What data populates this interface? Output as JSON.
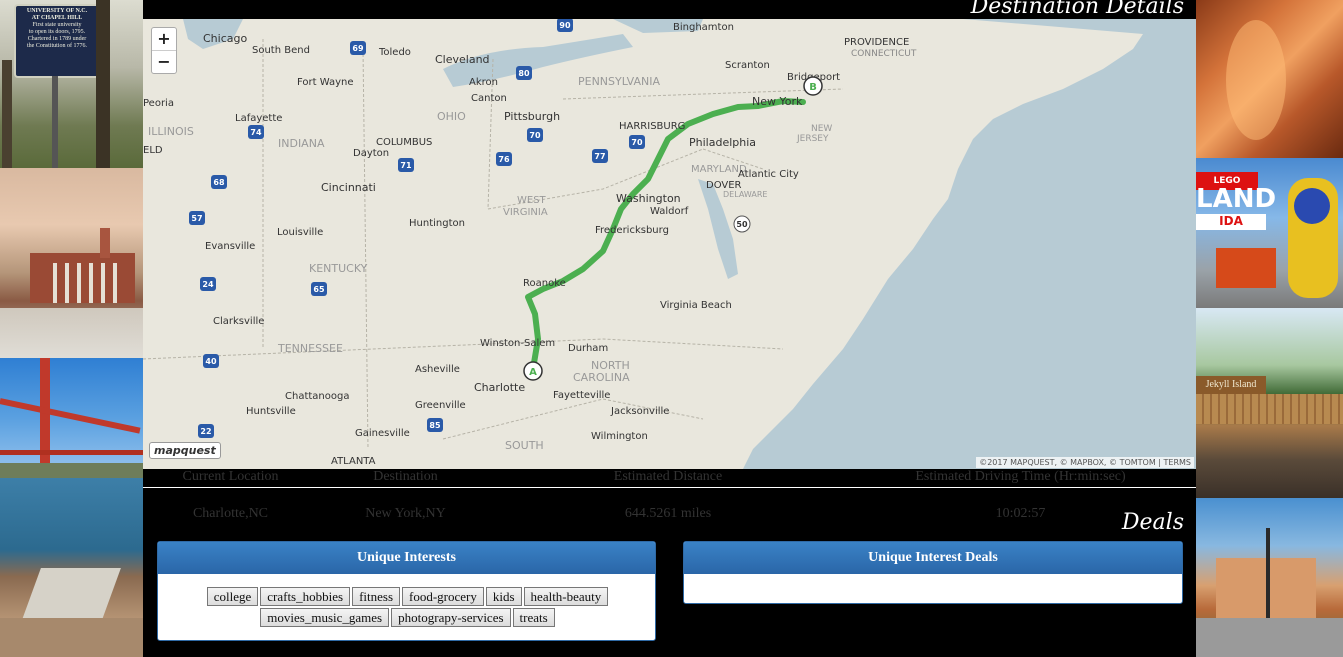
{
  "left_panel": {
    "sign_text": [
      "UNIVERSITY OF N.C.",
      "AT CHAPEL HILL",
      "First state university",
      "to open its doors, 1795.",
      "Chartered in 1789 under",
      "the Constitution of 1776."
    ]
  },
  "right_panel": {
    "legoland_text": "LAND",
    "legoland_sub": "IDA",
    "legoland_logo": "LEGO",
    "jekyll_sign": "Jekyll Island"
  },
  "section_titles": {
    "destination_details": "Destination Details",
    "deals": "Deals"
  },
  "map": {
    "zoom_in": "+",
    "zoom_out": "−",
    "logo": "mapquest",
    "attribution": "©2017 MAPQUEST, © MAPBOX, © TOMTOM | TERMS",
    "marker_a": "A",
    "marker_b": "B",
    "route_color": "#4caf50",
    "water_color": "#b7cbd4",
    "land_color": "#e9e7dd",
    "places": [
      {
        "name": "Chicago"
      },
      {
        "name": "South Bend"
      },
      {
        "name": "Toledo"
      },
      {
        "name": "Cleveland"
      },
      {
        "name": "Binghamton"
      },
      {
        "name": "PROVIDENCE"
      },
      {
        "name": "CONNECTICUT"
      },
      {
        "name": "Scranton"
      },
      {
        "name": "Bridgeport"
      },
      {
        "name": "PENNSYLVANIA"
      },
      {
        "name": "Akron"
      },
      {
        "name": "Canton"
      },
      {
        "name": "Fort Wayne"
      },
      {
        "name": "Peoria"
      },
      {
        "name": "Lafayette"
      },
      {
        "name": "OHIO"
      },
      {
        "name": "Pittsburgh"
      },
      {
        "name": "HARRISBURG"
      },
      {
        "name": "New York"
      },
      {
        "name": "ILLINOIS"
      },
      {
        "name": "INDIANA"
      },
      {
        "name": "COLUMBUS"
      },
      {
        "name": "Dayton"
      },
      {
        "name": "Philadelphia"
      },
      {
        "name": "NEW"
      },
      {
        "name": "JERSEY"
      },
      {
        "name": "MARYLAND"
      },
      {
        "name": "Atlantic City"
      },
      {
        "name": "Cincinnati"
      },
      {
        "name": "DOVER"
      },
      {
        "name": "DELAWARE"
      },
      {
        "name": "Washington"
      },
      {
        "name": "Waldorf"
      },
      {
        "name": "WEST"
      },
      {
        "name": "VIRGINIA"
      },
      {
        "name": "Huntington"
      },
      {
        "name": "Louisville"
      },
      {
        "name": "Fredericksburg"
      },
      {
        "name": "Evansville"
      },
      {
        "name": "KENTUCKY"
      },
      {
        "name": "Roanoke"
      },
      {
        "name": "Virginia Beach"
      },
      {
        "name": "Clarksville"
      },
      {
        "name": "TENNESSEE"
      },
      {
        "name": "Winston-Salem"
      },
      {
        "name": "Durham"
      },
      {
        "name": "NORTH"
      },
      {
        "name": "CAROLINA"
      },
      {
        "name": "Asheville"
      },
      {
        "name": "Charlotte"
      },
      {
        "name": "Fayetteville"
      },
      {
        "name": "Chattanooga"
      },
      {
        "name": "Greenville"
      },
      {
        "name": "Jacksonville"
      },
      {
        "name": "Huntsville"
      },
      {
        "name": "Wilmington"
      },
      {
        "name": "Gainesville"
      },
      {
        "name": "SOUTH"
      },
      {
        "name": "ATLANTA"
      },
      {
        "name": "ELD"
      }
    ],
    "shields": [
      "90",
      "69",
      "80",
      "74",
      "70",
      "70",
      "76",
      "71",
      "77",
      "68",
      "70",
      "70",
      "57",
      "50",
      "64",
      "65",
      "24",
      "40",
      "85",
      "22"
    ]
  },
  "trip": {
    "headers": [
      "Current Location",
      "Destination",
      "Estimated Distance",
      "Estimated Driving Time (Hr:min:sec)"
    ],
    "current_location": "Charlotte,NC",
    "destination": "New York,NY",
    "distance": "644.5261 miles",
    "driving_time": "10:02:57"
  },
  "interests": {
    "title": "Unique Interests",
    "chips": [
      "college",
      "crafts_hobbies",
      "fitness",
      "food-grocery",
      "kids",
      "health-beauty",
      "movies_music_games",
      "photograpy-services",
      "treats"
    ]
  },
  "deals_panel": {
    "title": "Unique Interest Deals"
  }
}
